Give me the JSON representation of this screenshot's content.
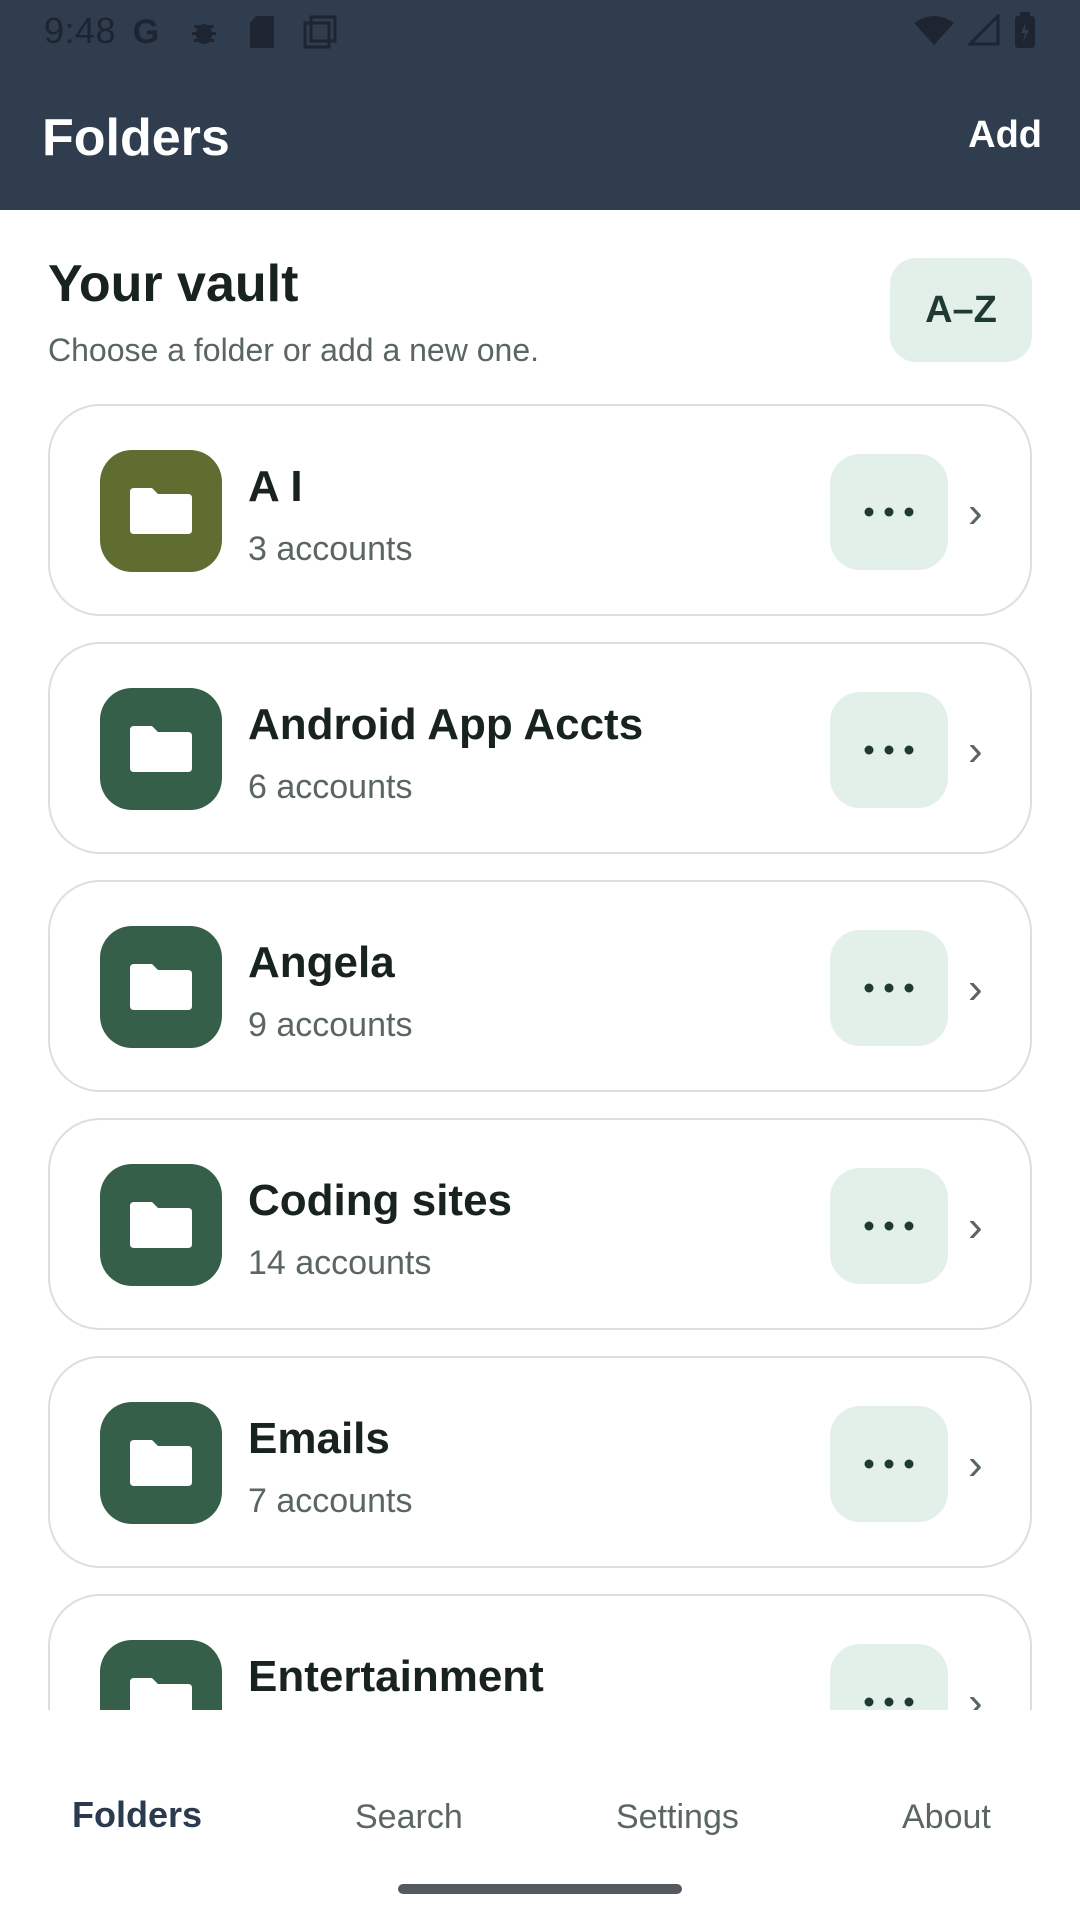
{
  "status_bar": {
    "time": "9:48",
    "left_icons": [
      "google-icon",
      "bug-icon",
      "sd-card-icon",
      "screenshot-icon"
    ],
    "right_icons": [
      "wifi-icon",
      "signal-icon",
      "battery-charging-icon"
    ]
  },
  "app_bar": {
    "title": "Folders",
    "add_label": "Add"
  },
  "vault": {
    "title": "Your vault",
    "subtitle": "Choose a folder or add a new one.",
    "sort_label": "A–Z"
  },
  "folders": [
    {
      "name": "A I",
      "count": "3 accounts",
      "color": "#5f6e30"
    },
    {
      "name": "Android App Accts",
      "count": "6 accounts",
      "color": "#365f4a"
    },
    {
      "name": "Angela",
      "count": "9 accounts",
      "color": "#365f4a"
    },
    {
      "name": "Coding sites",
      "count": "14 accounts",
      "color": "#365f4a"
    },
    {
      "name": "Emails",
      "count": "7 accounts",
      "color": "#365f4a"
    },
    {
      "name": "Entertainment",
      "count": "",
      "color": "#365f4a"
    }
  ],
  "more_icon": "more-horizontal-icon",
  "chevron_glyph": "›",
  "bottom_nav": {
    "items": [
      {
        "label": "Folders",
        "active": true
      },
      {
        "label": "Search",
        "active": false
      },
      {
        "label": "Settings",
        "active": false
      },
      {
        "label": "About",
        "active": false
      }
    ]
  },
  "colors": {
    "app_bar_bg": "#2f3d4f",
    "accent_bg": "#e3f0ea",
    "folder_green": "#365f4a",
    "folder_olive": "#5f6e30"
  }
}
